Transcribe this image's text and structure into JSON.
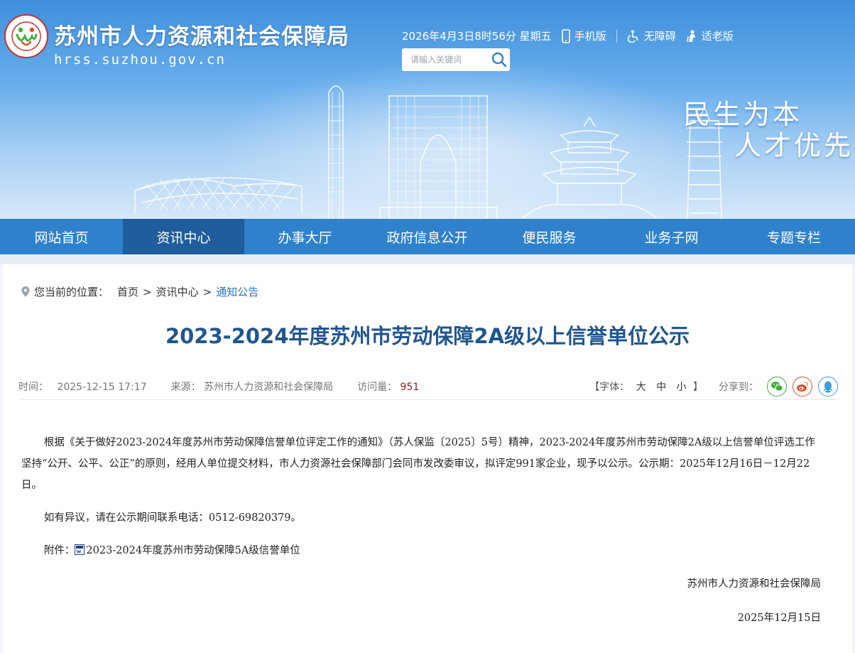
{
  "header": {
    "site_name": "苏州市人力资源和社会保障局",
    "site_domain": "hrss.suzhou.gov.cn",
    "datetime": "2026年4月3日8时56分 星期五",
    "mobile": "手机版",
    "accessibility": "无障碍",
    "elder": "适老版",
    "search_placeholder": "请输入关键词",
    "slogan_line1": "民生为本",
    "slogan_line2": "人才优先"
  },
  "nav": {
    "items": [
      {
        "label": "网站首页"
      },
      {
        "label": "资讯中心"
      },
      {
        "label": "办事大厅"
      },
      {
        "label": "政府信息公开"
      },
      {
        "label": "便民服务"
      },
      {
        "label": "业务子网"
      },
      {
        "label": "专题专栏"
      }
    ],
    "active_index": 1
  },
  "breadcrumb": {
    "prefix": "您当前的位置：",
    "items": [
      "首页",
      "资讯中心",
      "通知公告"
    ],
    "separator": ">"
  },
  "article": {
    "title": "2023-2024年度苏州市劳动保障2A级以上信誉单位公示",
    "time_label": "时间：",
    "time": "2025-12-15 17:17",
    "source_label": "来源：",
    "source": "苏州市人力资源和社会保障局",
    "views_label": "访问量：",
    "views": "951",
    "font_label_open": "【字体：",
    "font_large": "大",
    "font_medium": "中",
    "font_small": "小",
    "font_label_close": "】",
    "share_label": "分享到：",
    "para1": "根据《关于做好2023-2024年度苏州市劳动保障信誉单位评定工作的通知》（苏人保监〔2025〕5号）精神，2023-2024年度苏州市劳动保障2A级以上信誉单位评选工作坚持“公开、公平、公正”的原则，经用人单位提交材料，市人力资源社会保障部门会同市发改委审议，拟评定991家企业，现予以公示。公示期：2025年12月16日－12月22日。",
    "para2": "如有异议，请在公示期间联系电话：0512-69820379。",
    "attach_label": "附件：",
    "attach_name": "2023-2024年度苏州市劳动保障5A级信誉单位",
    "signature": "苏州市人力资源和社会保障局",
    "sign_date": "2025年12月15日"
  },
  "colors": {
    "nav_bg": "#2f81cc",
    "nav_active": "#1f5d9c",
    "title": "#21568e",
    "link": "#2a70b8",
    "views": "#8b1a1a",
    "wechat": "#3fae3a",
    "weibo": "#e0522c",
    "qq": "#3aa0dc"
  }
}
